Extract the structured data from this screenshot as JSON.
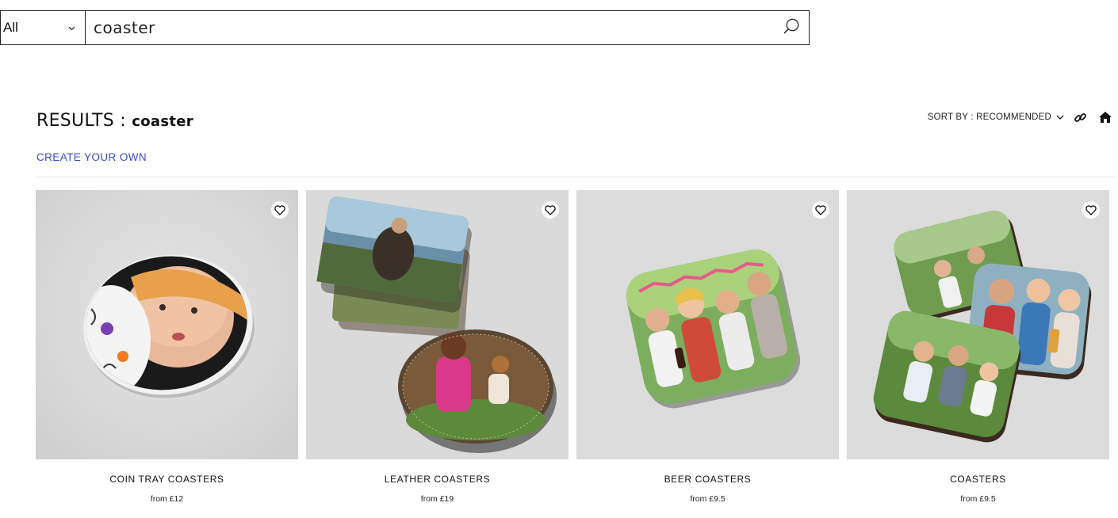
{
  "search": {
    "scope": "All",
    "query": "coaster"
  },
  "results": {
    "label": "RESULTS :",
    "query": "coaster",
    "create_link": "CREATE YOUR OWN"
  },
  "toolbar": {
    "sort_label": "SORT BY : RECOMMENDED",
    "icons": [
      "chevron-down-icon",
      "link-icon",
      "home-icon"
    ]
  },
  "products": [
    {
      "name": "COIN TRAY COASTERS",
      "price": "from £12"
    },
    {
      "name": "LEATHER COASTERS",
      "price": "from £19"
    },
    {
      "name": "BEER COASTERS",
      "price": "from £9.5"
    },
    {
      "name": "COASTERS",
      "price": "from £9.5"
    }
  ],
  "colors": {
    "link": "#3b4bd6",
    "thumb_bg": "#dcdcdc"
  }
}
